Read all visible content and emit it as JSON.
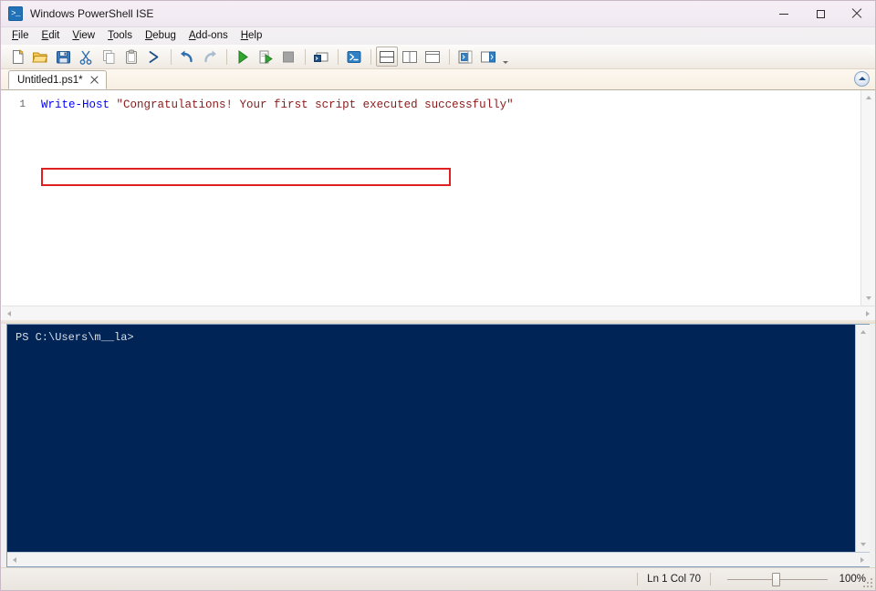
{
  "window": {
    "title": "Windows PowerShell ISE",
    "app_icon": "powershell-icon",
    "controls": {
      "minimize": "minimize-icon",
      "maximize": "maximize-icon",
      "close": "close-icon"
    }
  },
  "menu": {
    "items": [
      {
        "label": "File",
        "accel": "F",
        "rest": "ile"
      },
      {
        "label": "Edit",
        "accel": "E",
        "rest": "dit"
      },
      {
        "label": "View",
        "accel": "V",
        "rest": "iew"
      },
      {
        "label": "Tools",
        "accel": "T",
        "rest": "ools"
      },
      {
        "label": "Debug",
        "accel": "D",
        "rest": "ebug"
      },
      {
        "label": "Add-ons",
        "accel": "A",
        "rest": "dd-ons"
      },
      {
        "label": "Help",
        "accel": "H",
        "rest": "elp"
      }
    ]
  },
  "toolbar": {
    "buttons": [
      {
        "name": "new-script-button",
        "tooltip": "New"
      },
      {
        "name": "open-script-button",
        "tooltip": "Open"
      },
      {
        "name": "save-script-button",
        "tooltip": "Save"
      },
      {
        "name": "cut-button",
        "tooltip": "Cut"
      },
      {
        "name": "copy-button",
        "tooltip": "Copy"
      },
      {
        "name": "paste-button",
        "tooltip": "Paste"
      },
      {
        "name": "clear-console-button",
        "tooltip": "Clear Console Pane"
      },
      {
        "name": "undo-button",
        "tooltip": "Undo"
      },
      {
        "name": "redo-button",
        "tooltip": "Redo"
      },
      {
        "name": "run-script-button",
        "tooltip": "Run Script"
      },
      {
        "name": "run-selection-button",
        "tooltip": "Run Selection"
      },
      {
        "name": "stop-operation-button",
        "tooltip": "Stop Operation"
      },
      {
        "name": "new-remote-tab-button",
        "tooltip": "New Remote PowerShell Tab"
      },
      {
        "name": "start-powershell-button",
        "tooltip": "Start PowerShell.exe"
      },
      {
        "name": "layout-stacked-button",
        "tooltip": "Show Script Pane Top"
      },
      {
        "name": "layout-side-by-side-button",
        "tooltip": "Show Script Pane Right"
      },
      {
        "name": "layout-maximized-button",
        "tooltip": "Show Script Pane Maximized"
      },
      {
        "name": "show-commands-addon-button",
        "tooltip": "Show Command Add-on"
      },
      {
        "name": "show-command-window-button",
        "tooltip": "Show Command Window"
      }
    ]
  },
  "tabs": {
    "active": "Untitled1.ps1*",
    "close_icon": "close-icon",
    "collapse_icon": "chevron-up-icon"
  },
  "editor": {
    "line_number": "1",
    "code": {
      "cmdlet": "Write-Host",
      "space": " ",
      "string": "\"Congratulations! Your first script executed successfully\""
    },
    "full_line": "Write-Host \"Congratulations! Your first script executed successfully\"",
    "annotation": {
      "name": "red-highlight-box",
      "color": "#e02020"
    },
    "colors": {
      "cmdlet": "#0000ff",
      "string": "#8b1a1a",
      "line_number": "#606060",
      "background": "#ffffff"
    }
  },
  "console": {
    "prompt": "PS C:\\Users\\m__la>",
    "background": "#012456",
    "foreground": "#d8dfe8"
  },
  "status": {
    "position": "Ln 1  Col 70",
    "zoom_level": "100%"
  }
}
